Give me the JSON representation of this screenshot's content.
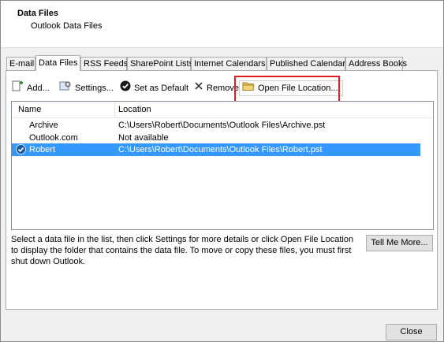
{
  "header": {
    "title": "Data Files",
    "subtitle": "Outlook Data Files"
  },
  "tabs": [
    {
      "label": "E-mail"
    },
    {
      "label": "Data Files"
    },
    {
      "label": "RSS Feeds"
    },
    {
      "label": "SharePoint Lists"
    },
    {
      "label": "Internet Calendars"
    },
    {
      "label": "Published Calendars"
    },
    {
      "label": "Address Books"
    }
  ],
  "toolbar": {
    "add_label": "Add...",
    "settings_label": "Settings...",
    "default_label": "Set as Default",
    "remove_label": "Remove",
    "open_label": "Open File Location..."
  },
  "list": {
    "columns": {
      "name": "Name",
      "location": "Location"
    },
    "rows": [
      {
        "name": "Archive",
        "location": "C:\\Users\\Robert\\Documents\\Outlook Files\\Archive.pst"
      },
      {
        "name": "Outlook.com",
        "location": "Not available"
      },
      {
        "name": "Robert",
        "location": "C:\\Users\\Robert\\Documents\\Outlook Files\\Robert.pst"
      }
    ]
  },
  "help": {
    "text": "Select a data file in the list, then click Settings for more details or click Open File Location to display the folder that contains the data file. To move or copy these files, you must first shut down Outlook."
  },
  "buttons": {
    "tell_me_more": "Tell Me More...",
    "close": "Close"
  },
  "colors": {
    "selection": "#3399ff",
    "highlight_border": "#e02020"
  }
}
